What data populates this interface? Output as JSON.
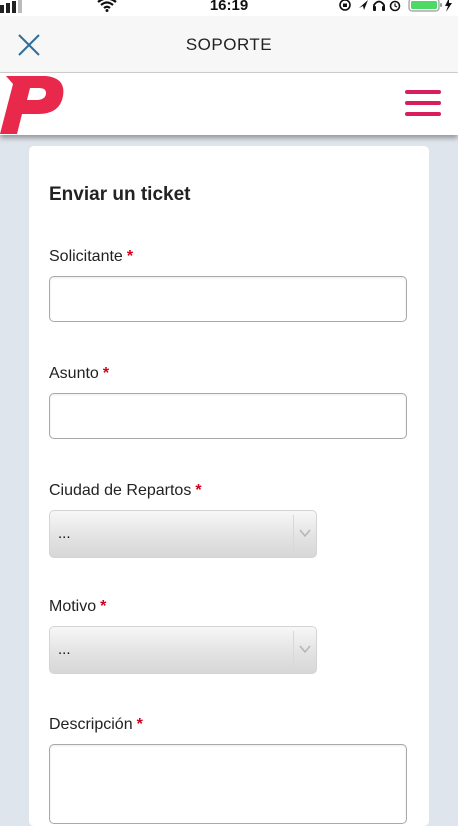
{
  "status_bar": {
    "time": "16:19"
  },
  "nav": {
    "title": "SOPORTE",
    "close_icon": "close-icon"
  },
  "header": {
    "logo_icon": "brand-p-logo",
    "menu_icon": "hamburger-menu-icon",
    "brand_color": "#e8294b",
    "menu_color": "#d81f5c"
  },
  "form": {
    "title": "Enviar un ticket",
    "required_marker": "*",
    "fields": [
      {
        "label": "Solicitante",
        "type": "text",
        "value": ""
      },
      {
        "label": "Asunto",
        "type": "text",
        "value": ""
      },
      {
        "label": "Ciudad de Repartos",
        "type": "select",
        "value": "..."
      },
      {
        "label": "Motivo",
        "type": "select",
        "value": "..."
      },
      {
        "label": "Descripción",
        "type": "textarea",
        "value": ""
      }
    ]
  }
}
